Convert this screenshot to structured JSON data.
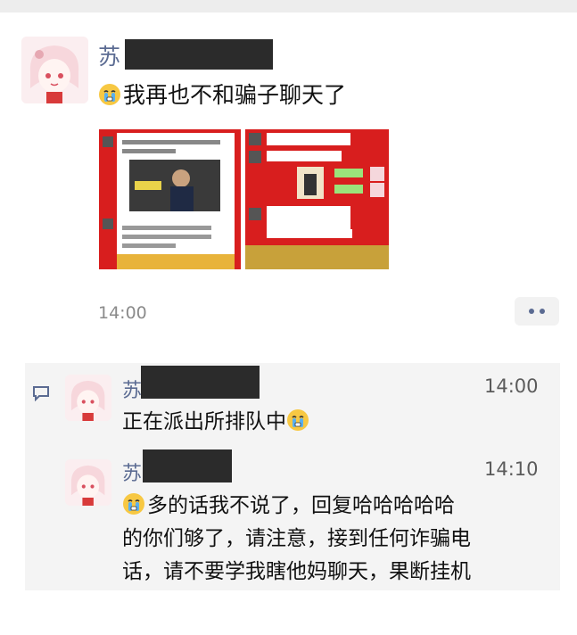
{
  "post": {
    "author_visible": "苏",
    "text": "我再也不和骗子聊天了",
    "time": "14:00"
  },
  "comments": [
    {
      "author_visible": "苏",
      "time": "14:00",
      "text": "正在派出所排队中"
    },
    {
      "author_visible": "苏",
      "time": "14:10",
      "lines": [
        "多的话我不说了，回复哈哈哈哈哈",
        "的你们够了，请注意，接到任何诈骗电",
        "话，请不要学我瞎他妈聊天，果断挂机"
      ]
    }
  ],
  "icons": {
    "emoji": "crying-face-icon",
    "more": "more-dots-icon",
    "comment": "comment-icon"
  },
  "colors": {
    "name": "#5b6b92",
    "redaction": "#2b2b2b",
    "image_bg": "#d81e1e"
  }
}
